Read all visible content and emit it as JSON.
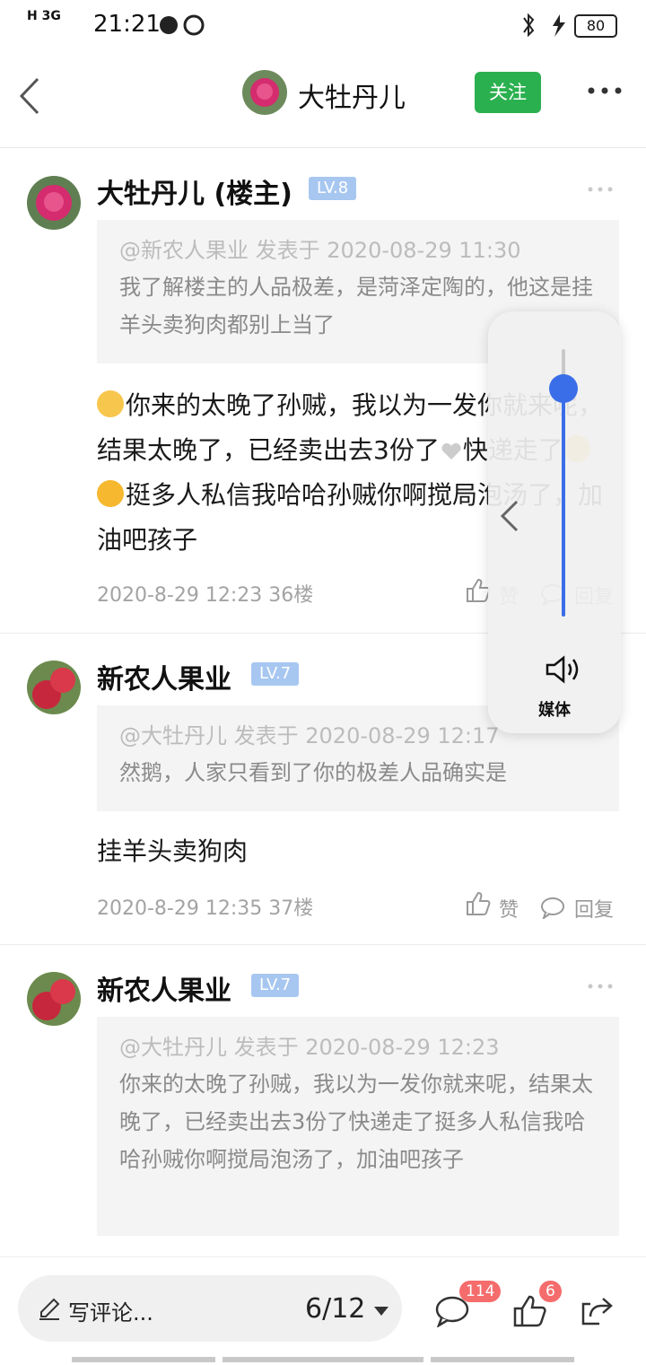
{
  "status_bar": {
    "signal": "H 3G",
    "time": "21:21",
    "battery": "80"
  },
  "header": {
    "title": "大牡丹儿",
    "follow_label": "关注"
  },
  "posts": [
    {
      "username": "大牡丹儿 (楼主)",
      "level": "LV.8",
      "quote_header": "@新农人果业 发表于 2020-08-29 11:30",
      "quote_text": "我了解楼主的人品极差，是菏泽定陶的，他这是挂羊头卖狗肉都别上当了",
      "content_1": "你来的太晚了孙贼，我以为一发你就来呢，结果太晚了，已经卖出去3份了",
      "content_2": "快递走了",
      "content_3": "挺多人私信我哈哈孙贼你啊搅局泡汤了，加油吧孩子",
      "time_floor": "2020-8-29 12:23  36楼",
      "like_label": "赞",
      "reply_label": "回复"
    },
    {
      "username": "新农人果业",
      "level": "LV.7",
      "quote_header": "@大牡丹儿 发表于 2020-08-29 12:17",
      "quote_text": "然鹅，人家只看到了你的极差人品确实是",
      "content": "挂羊头卖狗肉",
      "time_floor": "2020-8-29 12:35  37楼",
      "like_label": "赞",
      "reply_label": "回复"
    },
    {
      "username": "新农人果业",
      "level": "LV.7",
      "quote_header": "@大牡丹儿 发表于 2020-08-29 12:23",
      "quote_text": "你来的太晚了孙贼，我以为一发你就来呢，结果太晚了，已经卖出去3份了快递走了挺多人私信我哈哈孙贼你啊搅局泡汤了，加油吧孩子"
    }
  ],
  "volume_overlay": {
    "label": "媒体",
    "level_fraction": 0.85
  },
  "bottom_bar": {
    "comment_placeholder": "写评论...",
    "page_indicator": "6/12",
    "comment_count": "114",
    "like_count": "6"
  },
  "colors": {
    "follow_green": "#2bb04f",
    "level_badge": "#a7c7f0",
    "volume_blue": "#3a6ee8",
    "badge_red": "#f56c6c"
  }
}
